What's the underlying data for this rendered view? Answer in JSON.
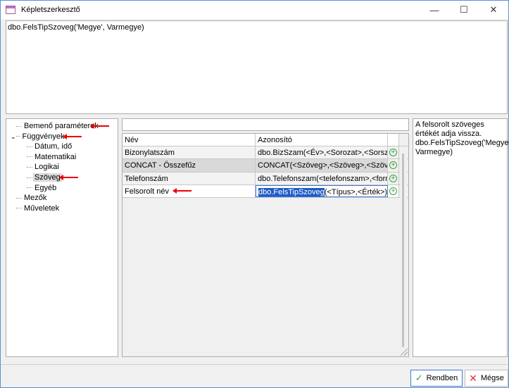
{
  "window": {
    "title": "Képletszerkesztő",
    "minimize": "—",
    "maximize": "☐",
    "close": "✕"
  },
  "formula": "dbo.FelsTipSzoveg('Megye', Varmegye)",
  "tree": [
    {
      "label": "Bemenő paraméterek",
      "level": 0,
      "arrow": true
    },
    {
      "label": "Függvények",
      "level": 0,
      "expanded": true,
      "arrow": true
    },
    {
      "label": "Dátum, idő",
      "level": 1
    },
    {
      "label": "Matematikai",
      "level": 1
    },
    {
      "label": "Logikai",
      "level": 1
    },
    {
      "label": "Szöveg",
      "level": 1,
      "selected": true,
      "arrow": true
    },
    {
      "label": "Egyéb",
      "level": 1
    },
    {
      "label": "Mezők",
      "level": 0
    },
    {
      "label": "Műveletek",
      "level": 0
    }
  ],
  "search": {
    "value": ""
  },
  "grid": {
    "headers": [
      "Név",
      "Azonosító"
    ],
    "rows": [
      {
        "name": "Bizonylatszám",
        "id": "dbo.BizSzam(<Év>,<Sorozat>,<Sorszam>)"
      },
      {
        "name": "CONCAT - Összefűz",
        "id": "CONCAT(<Szöveg>,<Szöveg>,<Szöveg>)"
      },
      {
        "name": "Telefonszám",
        "id": "dbo.Telefonszam(<telefonszam>,<forma>"
      },
      {
        "name": "Felsorolt név",
        "id_selected": "dbo.FelsTipSzoveg",
        "id_rest": "(<Típus>,<Érték>)"
      }
    ]
  },
  "description": "A felsorolt szöveges értékét adja vissza. dbo.FelsTipSzoveg('Megye', Varmegye)",
  "buttons": {
    "ok": "Rendben",
    "cancel": "Mégse"
  },
  "colors": {
    "accent": "#3d7bd6",
    "arrow": "#e00000",
    "ok_icon": "#3aa03a",
    "cancel_icon": "#e03030"
  }
}
